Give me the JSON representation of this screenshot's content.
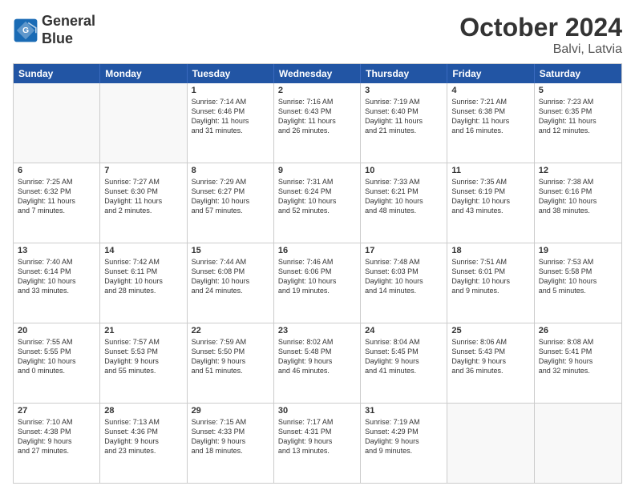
{
  "logo": {
    "line1": "General",
    "line2": "Blue"
  },
  "title": "October 2024",
  "location": "Balvi, Latvia",
  "header_days": [
    "Sunday",
    "Monday",
    "Tuesday",
    "Wednesday",
    "Thursday",
    "Friday",
    "Saturday"
  ],
  "weeks": [
    [
      {
        "day": "",
        "text": ""
      },
      {
        "day": "",
        "text": ""
      },
      {
        "day": "1",
        "text": "Sunrise: 7:14 AM\nSunset: 6:46 PM\nDaylight: 11 hours\nand 31 minutes."
      },
      {
        "day": "2",
        "text": "Sunrise: 7:16 AM\nSunset: 6:43 PM\nDaylight: 11 hours\nand 26 minutes."
      },
      {
        "day": "3",
        "text": "Sunrise: 7:19 AM\nSunset: 6:40 PM\nDaylight: 11 hours\nand 21 minutes."
      },
      {
        "day": "4",
        "text": "Sunrise: 7:21 AM\nSunset: 6:38 PM\nDaylight: 11 hours\nand 16 minutes."
      },
      {
        "day": "5",
        "text": "Sunrise: 7:23 AM\nSunset: 6:35 PM\nDaylight: 11 hours\nand 12 minutes."
      }
    ],
    [
      {
        "day": "6",
        "text": "Sunrise: 7:25 AM\nSunset: 6:32 PM\nDaylight: 11 hours\nand 7 minutes."
      },
      {
        "day": "7",
        "text": "Sunrise: 7:27 AM\nSunset: 6:30 PM\nDaylight: 11 hours\nand 2 minutes."
      },
      {
        "day": "8",
        "text": "Sunrise: 7:29 AM\nSunset: 6:27 PM\nDaylight: 10 hours\nand 57 minutes."
      },
      {
        "day": "9",
        "text": "Sunrise: 7:31 AM\nSunset: 6:24 PM\nDaylight: 10 hours\nand 52 minutes."
      },
      {
        "day": "10",
        "text": "Sunrise: 7:33 AM\nSunset: 6:21 PM\nDaylight: 10 hours\nand 48 minutes."
      },
      {
        "day": "11",
        "text": "Sunrise: 7:35 AM\nSunset: 6:19 PM\nDaylight: 10 hours\nand 43 minutes."
      },
      {
        "day": "12",
        "text": "Sunrise: 7:38 AM\nSunset: 6:16 PM\nDaylight: 10 hours\nand 38 minutes."
      }
    ],
    [
      {
        "day": "13",
        "text": "Sunrise: 7:40 AM\nSunset: 6:14 PM\nDaylight: 10 hours\nand 33 minutes."
      },
      {
        "day": "14",
        "text": "Sunrise: 7:42 AM\nSunset: 6:11 PM\nDaylight: 10 hours\nand 28 minutes."
      },
      {
        "day": "15",
        "text": "Sunrise: 7:44 AM\nSunset: 6:08 PM\nDaylight: 10 hours\nand 24 minutes."
      },
      {
        "day": "16",
        "text": "Sunrise: 7:46 AM\nSunset: 6:06 PM\nDaylight: 10 hours\nand 19 minutes."
      },
      {
        "day": "17",
        "text": "Sunrise: 7:48 AM\nSunset: 6:03 PM\nDaylight: 10 hours\nand 14 minutes."
      },
      {
        "day": "18",
        "text": "Sunrise: 7:51 AM\nSunset: 6:01 PM\nDaylight: 10 hours\nand 9 minutes."
      },
      {
        "day": "19",
        "text": "Sunrise: 7:53 AM\nSunset: 5:58 PM\nDaylight: 10 hours\nand 5 minutes."
      }
    ],
    [
      {
        "day": "20",
        "text": "Sunrise: 7:55 AM\nSunset: 5:55 PM\nDaylight: 10 hours\nand 0 minutes."
      },
      {
        "day": "21",
        "text": "Sunrise: 7:57 AM\nSunset: 5:53 PM\nDaylight: 9 hours\nand 55 minutes."
      },
      {
        "day": "22",
        "text": "Sunrise: 7:59 AM\nSunset: 5:50 PM\nDaylight: 9 hours\nand 51 minutes."
      },
      {
        "day": "23",
        "text": "Sunrise: 8:02 AM\nSunset: 5:48 PM\nDaylight: 9 hours\nand 46 minutes."
      },
      {
        "day": "24",
        "text": "Sunrise: 8:04 AM\nSunset: 5:45 PM\nDaylight: 9 hours\nand 41 minutes."
      },
      {
        "day": "25",
        "text": "Sunrise: 8:06 AM\nSunset: 5:43 PM\nDaylight: 9 hours\nand 36 minutes."
      },
      {
        "day": "26",
        "text": "Sunrise: 8:08 AM\nSunset: 5:41 PM\nDaylight: 9 hours\nand 32 minutes."
      }
    ],
    [
      {
        "day": "27",
        "text": "Sunrise: 7:10 AM\nSunset: 4:38 PM\nDaylight: 9 hours\nand 27 minutes."
      },
      {
        "day": "28",
        "text": "Sunrise: 7:13 AM\nSunset: 4:36 PM\nDaylight: 9 hours\nand 23 minutes."
      },
      {
        "day": "29",
        "text": "Sunrise: 7:15 AM\nSunset: 4:33 PM\nDaylight: 9 hours\nand 18 minutes."
      },
      {
        "day": "30",
        "text": "Sunrise: 7:17 AM\nSunset: 4:31 PM\nDaylight: 9 hours\nand 13 minutes."
      },
      {
        "day": "31",
        "text": "Sunrise: 7:19 AM\nSunset: 4:29 PM\nDaylight: 9 hours\nand 9 minutes."
      },
      {
        "day": "",
        "text": ""
      },
      {
        "day": "",
        "text": ""
      }
    ]
  ]
}
